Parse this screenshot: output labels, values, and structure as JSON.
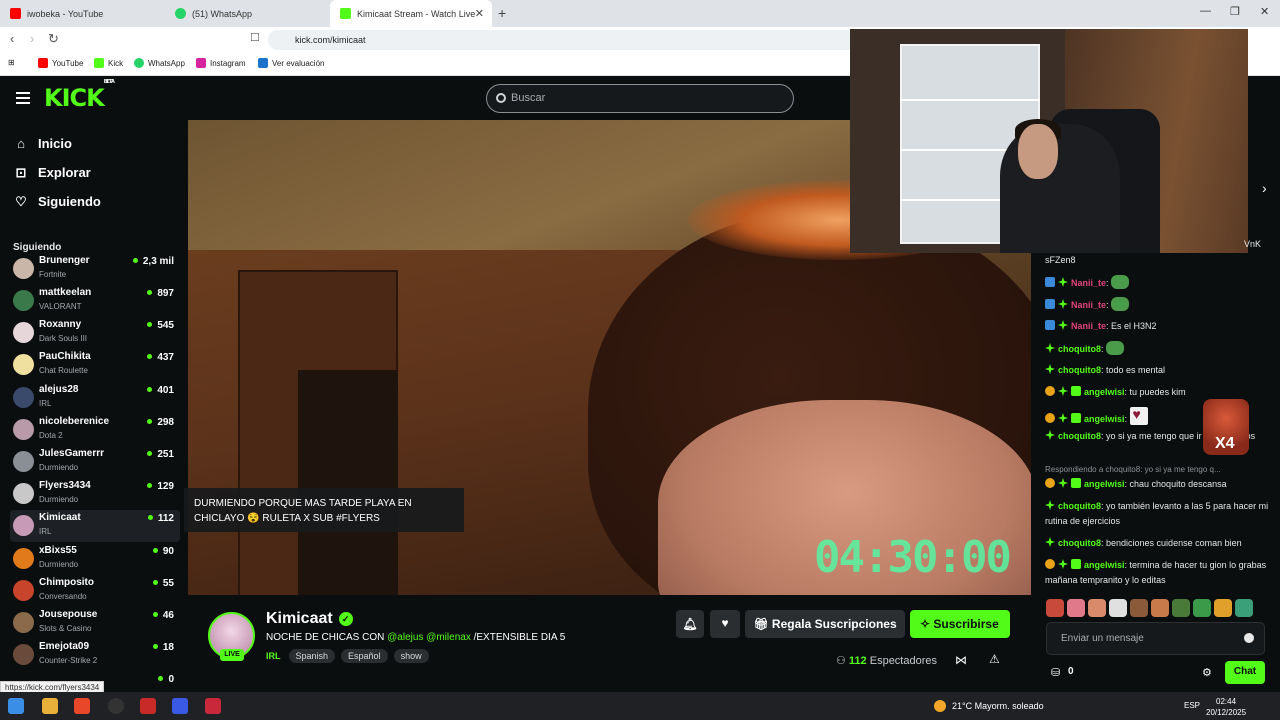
{
  "browser": {
    "tabs": [
      {
        "label": "iwobeka - YouTube"
      },
      {
        "label": "(51) WhatsApp"
      },
      {
        "label": "Kimicaat Stream - Watch Live"
      }
    ],
    "url": "kick.com/kimicaat",
    "bookmarks": [
      "YouTube",
      "Kick",
      "WhatsApp",
      "Instagram",
      "Ver evaluación"
    ],
    "status_url": "https://kick.com/flyers3434"
  },
  "header": {
    "logo": "KICK",
    "logo_sup": "BETA",
    "search_placeholder": "Buscar"
  },
  "sidebar": {
    "nav": [
      {
        "label": "Inicio",
        "icon": "home-icon"
      },
      {
        "label": "Explorar",
        "icon": "compass-icon"
      },
      {
        "label": "Siguiendo",
        "icon": "heart-icon"
      }
    ],
    "section_title": "Siguiendo",
    "channels": [
      {
        "name": "Brunenger",
        "category": "Fortnite",
        "viewers": "2,3 mil",
        "color": "#c9b6a8"
      },
      {
        "name": "mattkeelan",
        "category": "VALORANT",
        "viewers": "897",
        "color": "#3a7a4a"
      },
      {
        "name": "Roxanny",
        "category": "Dark Souls III",
        "viewers": "545",
        "color": "#e6d6da"
      },
      {
        "name": "PauChikita",
        "category": "Chat Roulette",
        "viewers": "437",
        "color": "#f0e0a0"
      },
      {
        "name": "alejus28",
        "category": "IRL",
        "viewers": "401",
        "color": "#3a4a6a"
      },
      {
        "name": "nicoleberenice",
        "category": "Dota 2",
        "viewers": "298",
        "color": "#b89aa8"
      },
      {
        "name": "JulesGamerrr",
        "category": "Durmiendo",
        "viewers": "251",
        "color": "#8a8f96"
      },
      {
        "name": "Flyers3434",
        "category": "Durmiendo",
        "viewers": "129",
        "color": "#c8c8c8"
      },
      {
        "name": "Kimicaat",
        "category": "IRL",
        "viewers": "112",
        "color": "#c79ab8"
      },
      {
        "name": "xBixs55",
        "category": "Durmiendo",
        "viewers": "90",
        "color": "#e07a1a"
      },
      {
        "name": "Chimposito",
        "category": "Conversando",
        "viewers": "55",
        "color": "#c8442a"
      },
      {
        "name": "Jousepouse",
        "category": "Slots & Casino",
        "viewers": "46",
        "color": "#8a6a4a"
      },
      {
        "name": "Emejota09",
        "category": "Counter-Strike 2",
        "viewers": "18",
        "color": "#6a4a3a"
      },
      {
        "name": "",
        "category": "",
        "viewers": "0",
        "color": "#555"
      }
    ]
  },
  "video": {
    "timer": "04:30:00",
    "caption": "DURMIENDO PORQUE MAS TARDE PLAYA EN CHICLAYO 😵 RULETA X SUB #FLYERS"
  },
  "chat": {
    "top_fragment": "sFZen8",
    "top_fragment_right": "VnK",
    "messages": [
      {
        "user": "Nanii_te",
        "color": "#e0457a",
        "text": "",
        "emote": true
      },
      {
        "user": "Nanii_te",
        "color": "#e0457a",
        "text": "",
        "emote": true
      },
      {
        "user": "Nanii_te",
        "color": "#e0457a",
        "text": "Es el H3N2"
      },
      {
        "user": "choquito8",
        "color": "#53fc18",
        "text": "",
        "emote": true
      },
      {
        "user": "choquito8",
        "color": "#53fc18",
        "text": "todo es mental"
      },
      {
        "user": "angelwisi",
        "color": "#53fc18",
        "text": "tu puedes kim"
      },
      {
        "user": "angelwisi",
        "color": "#53fc18",
        "text": "",
        "heart": true
      },
      {
        "user": "choquito8",
        "color": "#53fc18",
        "text": "yo si ya me tengo que ir muchanchos"
      },
      {
        "user": "angelwisi",
        "color": "#53fc18",
        "text": "chau choquito descansa"
      },
      {
        "user": "choquito8",
        "color": "#53fc18",
        "text": "yo también levanto a las 5 para hacer mi rutina de ejercicios"
      },
      {
        "user": "choquito8",
        "color": "#53fc18",
        "text": "bendiciones cuidense coman bien"
      },
      {
        "user": "angelwisi",
        "color": "#53fc18",
        "text": "termina de hacer tu gion lo grabas mañana tempranito y lo editas"
      }
    ],
    "reply_line": "Respondiendo a choquito8: yo si ya me tengo q...",
    "sticker_count": "X4",
    "input_placeholder": "Enviar un mensaje",
    "points": "0",
    "send_label": "Chat"
  },
  "stream": {
    "name": "Kimicaat",
    "live_label": "LIVE",
    "title_prefix": "NOCHE DE CHICAS CON",
    "mention1": "@alejus",
    "mention2": "@milenax",
    "title_suffix": "/EXTENSIBLE DIA 5",
    "category": "IRL",
    "tags": [
      "Spanish",
      "Español",
      "show"
    ],
    "gift_label": "Regala Suscripciones",
    "subscribe_label": "Suscribirse",
    "viewers_count": "112",
    "viewers_label": "Espectadores"
  },
  "taskbar": {
    "weather": "21°C  Mayorm. soleado",
    "lang": "ESP",
    "time": "02:44",
    "date": "20/12/2025"
  }
}
